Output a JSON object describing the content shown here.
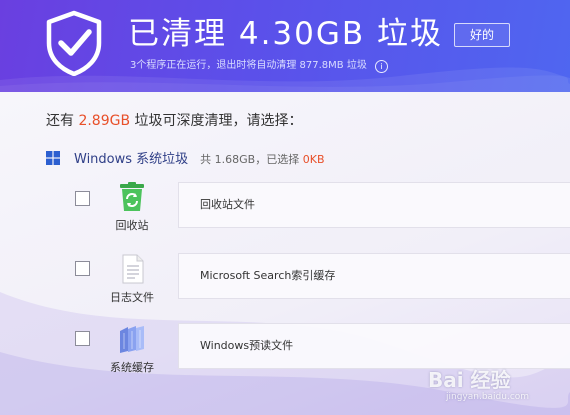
{
  "header": {
    "title": "已清理 4.30GB 垃圾",
    "subtitle": "3个程序正在运行，退出时将自动清理 877.8MB 垃圾",
    "info_glyph": "i",
    "ok_label": "好的"
  },
  "main": {
    "prompt_prefix": "还有 ",
    "prompt_amount": "2.89GB",
    "prompt_suffix": " 垃圾可深度清理，请选择：",
    "group": {
      "name": "Windows 系统垃圾",
      "stats_prefix": "共 1.68GB，已选择 ",
      "stats_selected": "0KB"
    },
    "items": [
      {
        "label": "回收站",
        "panel": "回收站文件",
        "icon": "recycle-bin-icon",
        "checked": false
      },
      {
        "label": "日志文件",
        "panel": "Microsoft Search索引缓存",
        "icon": "log-file-icon",
        "checked": false
      },
      {
        "label": "系统缓存",
        "panel": "Windows预读文件",
        "icon": "system-cache-icon",
        "checked": false
      }
    ]
  },
  "watermark": {
    "brand": "Bai 经验",
    "url": "jingyan.baidu.com"
  },
  "colors": {
    "header_start": "#6a3fe0",
    "header_end": "#4f66f0",
    "accent": "#e8502a",
    "group_text": "#2f3f87"
  }
}
